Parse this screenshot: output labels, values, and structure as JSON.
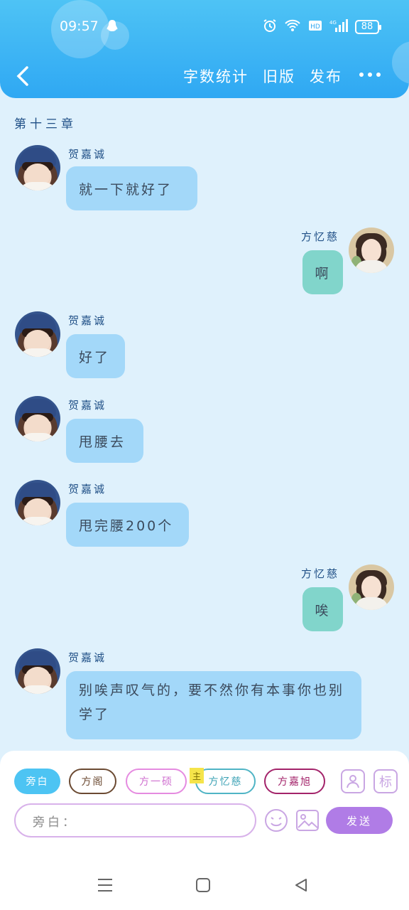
{
  "status_bar": {
    "time": "09:57",
    "battery": "88",
    "icons": [
      "qq-icon",
      "alarm-icon",
      "wifi-icon",
      "hd-icon",
      "signal-4g-icon",
      "battery-icon"
    ]
  },
  "header": {
    "back_icon": "chevron-left-icon",
    "actions": [
      "字数统计",
      "旧版",
      "发布"
    ],
    "more_icon": "more-dots-icon"
  },
  "chapter_title": "第十三章",
  "messages": [
    {
      "side": "left",
      "name": "贺嘉诚",
      "text": "就一下就好了"
    },
    {
      "side": "right",
      "name": "方忆慈",
      "text": "啊"
    },
    {
      "side": "left",
      "name": "贺嘉诚",
      "text": "好了"
    },
    {
      "side": "left",
      "name": "贺嘉诚",
      "text": "甩腰去"
    },
    {
      "side": "left",
      "name": "贺嘉诚",
      "text": "甩完腰200个"
    },
    {
      "side": "right",
      "name": "方忆慈",
      "text": "唉"
    },
    {
      "side": "left",
      "name": "贺嘉诚",
      "text": "别唉声叹气的，要不然你有本事你也别学了"
    }
  ],
  "composer": {
    "roles": [
      "旁白",
      "方阁",
      "方一硕",
      "方忆慈",
      "方嘉旭"
    ],
    "main_tag": "主",
    "label_button": "标",
    "input_placeholder": "旁白：",
    "send_label": "发送"
  },
  "colors": {
    "header": "#2fa8f3",
    "background": "#dff1fc",
    "left_bubble": "#a3d8f9",
    "right_bubble": "#81d5cb",
    "send": "#b07ce6"
  }
}
